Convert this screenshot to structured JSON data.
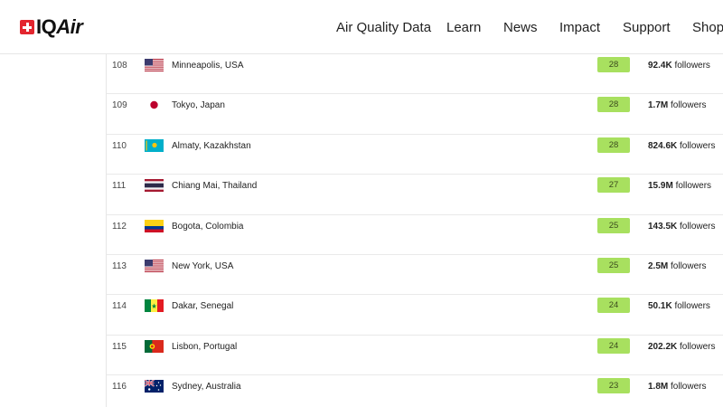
{
  "brand": {
    "name_part1": "IQ",
    "name_part2": "Air",
    "accent": "#e3262f"
  },
  "nav": [
    {
      "label": "Air Quality Data"
    },
    {
      "label": "Learn"
    },
    {
      "label": "News"
    },
    {
      "label": "Impact"
    },
    {
      "label": "Support"
    },
    {
      "label": "Shop"
    }
  ],
  "aqi_color": "#a8e05f",
  "rows": [
    {
      "rank": "108",
      "city": "Minneapolis, USA",
      "flag": "us",
      "aqi": "28",
      "followers": "92.4K",
      "followers_suffix": "followers"
    },
    {
      "rank": "109",
      "city": "Tokyo, Japan",
      "flag": "jp",
      "aqi": "28",
      "followers": "1.7M",
      "followers_suffix": "followers"
    },
    {
      "rank": "110",
      "city": "Almaty, Kazakhstan",
      "flag": "kz",
      "aqi": "28",
      "followers": "824.6K",
      "followers_suffix": "followers"
    },
    {
      "rank": "111",
      "city": "Chiang Mai, Thailand",
      "flag": "th",
      "aqi": "27",
      "followers": "15.9M",
      "followers_suffix": "followers"
    },
    {
      "rank": "112",
      "city": "Bogota, Colombia",
      "flag": "co",
      "aqi": "25",
      "followers": "143.5K",
      "followers_suffix": "followers"
    },
    {
      "rank": "113",
      "city": "New York, USA",
      "flag": "us",
      "aqi": "25",
      "followers": "2.5M",
      "followers_suffix": "followers"
    },
    {
      "rank": "114",
      "city": "Dakar, Senegal",
      "flag": "sn",
      "aqi": "24",
      "followers": "50.1K",
      "followers_suffix": "followers"
    },
    {
      "rank": "115",
      "city": "Lisbon, Portugal",
      "flag": "pt",
      "aqi": "24",
      "followers": "202.2K",
      "followers_suffix": "followers"
    },
    {
      "rank": "116",
      "city": "Sydney, Australia",
      "flag": "au",
      "aqi": "23",
      "followers": "1.8M",
      "followers_suffix": "followers"
    }
  ]
}
